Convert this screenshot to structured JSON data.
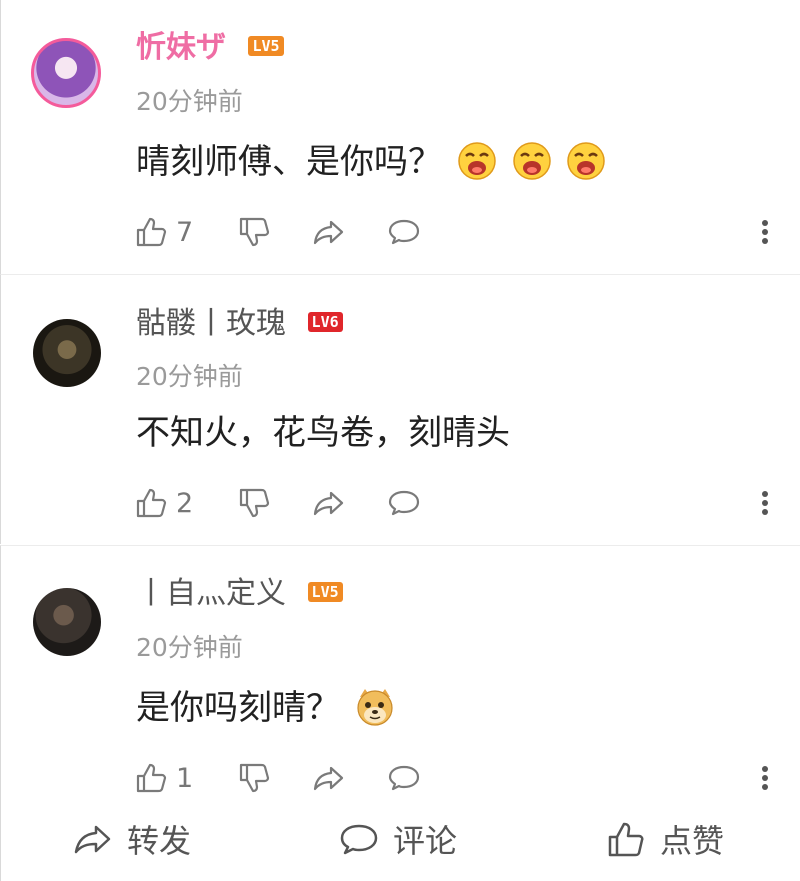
{
  "comments": [
    {
      "username": "忻妹ザ",
      "level": "LV5",
      "time": "20分钟前",
      "text": "晴刻师傅、是你吗？",
      "likes": "7"
    },
    {
      "username": "骷髅丨玫瑰",
      "level": "LV6",
      "time": "20分钟前",
      "text": "不知火，花鸟卷，刻晴头",
      "likes": "2"
    },
    {
      "username": "丨自灬定义",
      "level": "LV5",
      "time": "20分钟前",
      "text": "是你吗刻晴？",
      "likes": "1"
    }
  ],
  "bottom_bar": {
    "forward": "转发",
    "comment": "评论",
    "like": "点赞"
  },
  "colors": {
    "vip_name": "#ef6da4",
    "level5": "#f08a24",
    "level6": "#e0262b",
    "muted_text": "#9a9a9a",
    "icon": "#7a7a7a"
  }
}
